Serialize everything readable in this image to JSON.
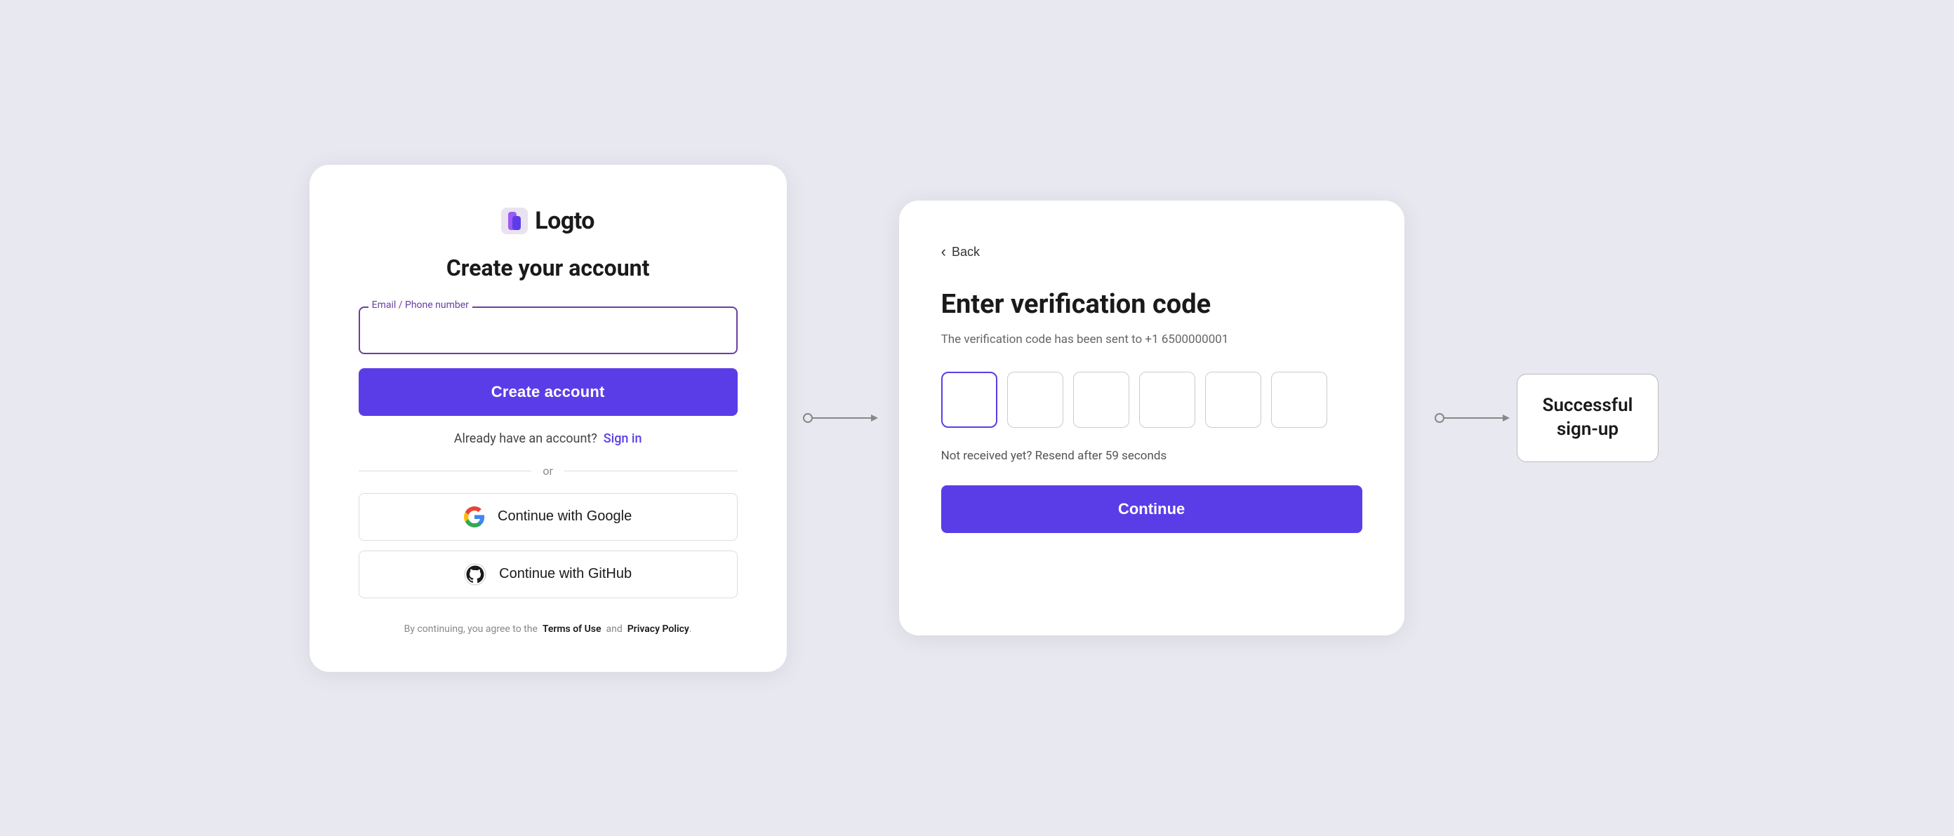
{
  "page": {
    "bg_color": "#e8e8f0"
  },
  "left_card": {
    "logo_text": "Logto",
    "title": "Create your account",
    "input_label": "Email / Phone number",
    "input_placeholder": "",
    "create_account_btn": "Create account",
    "signin_text": "Already have an account?",
    "signin_link": "Sign in",
    "or_text": "or",
    "google_btn": "Continue with Google",
    "github_btn": "Continue with GitHub",
    "terms_text_before": "By continuing, you agree to the",
    "terms_of_use": "Terms of Use",
    "terms_and": "and",
    "privacy_policy": "Privacy Policy",
    "terms_period": "."
  },
  "right_card": {
    "back_label": "Back",
    "title": "Enter verification code",
    "subtitle": "The verification code has been sent to +1 6500000001",
    "resend_text": "Not received yet? Resend after 59 seconds",
    "continue_btn": "Continue"
  },
  "success_box": {
    "line1": "Successful",
    "line2": "sign-up"
  },
  "icons": {
    "back_arrow": "‹",
    "arrow_connector": "→"
  }
}
